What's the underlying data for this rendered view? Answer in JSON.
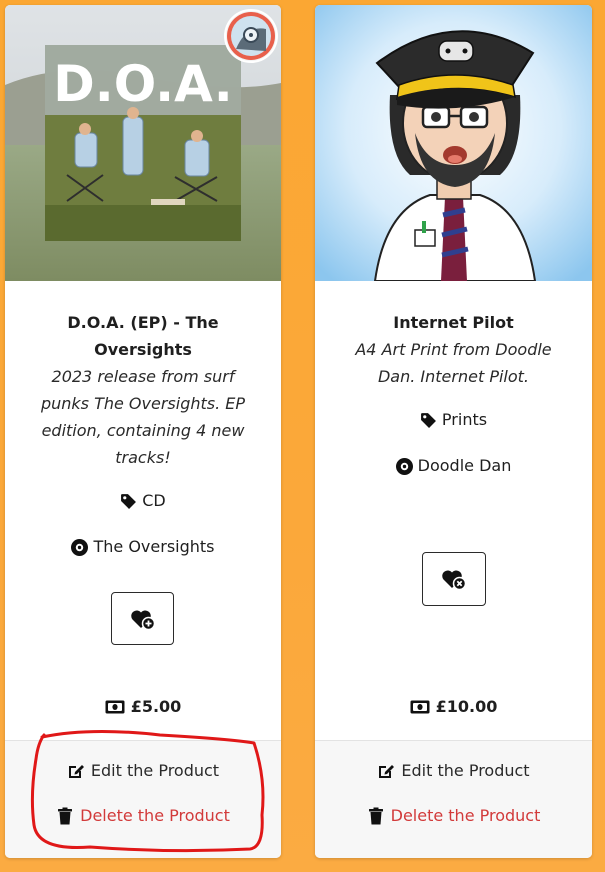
{
  "products": [
    {
      "art_title": "D.O.A.",
      "title": "D.O.A. (EP) - The Oversights",
      "description": "2023 release from surf punks The Oversights. EP edition, containing 4 new tracks!",
      "category": "CD",
      "artist": "The Oversights",
      "wishlist_icon": "heart-plus-icon",
      "price": "£5.00",
      "edit_label": "Edit the Product",
      "delete_label": "Delete the Product"
    },
    {
      "title": "Internet Pilot",
      "description": "A4 Art Print from Doodle Dan. Internet Pilot.",
      "category": "Prints",
      "artist": "Doodle Dan",
      "wishlist_icon": "heart-remove-icon",
      "price": "£10.00",
      "edit_label": "Edit the Product",
      "delete_label": "Delete the Product"
    }
  ],
  "colors": {
    "page_background": "#fba733",
    "delete_text": "#d23a3a",
    "annotation": "#e01818"
  }
}
